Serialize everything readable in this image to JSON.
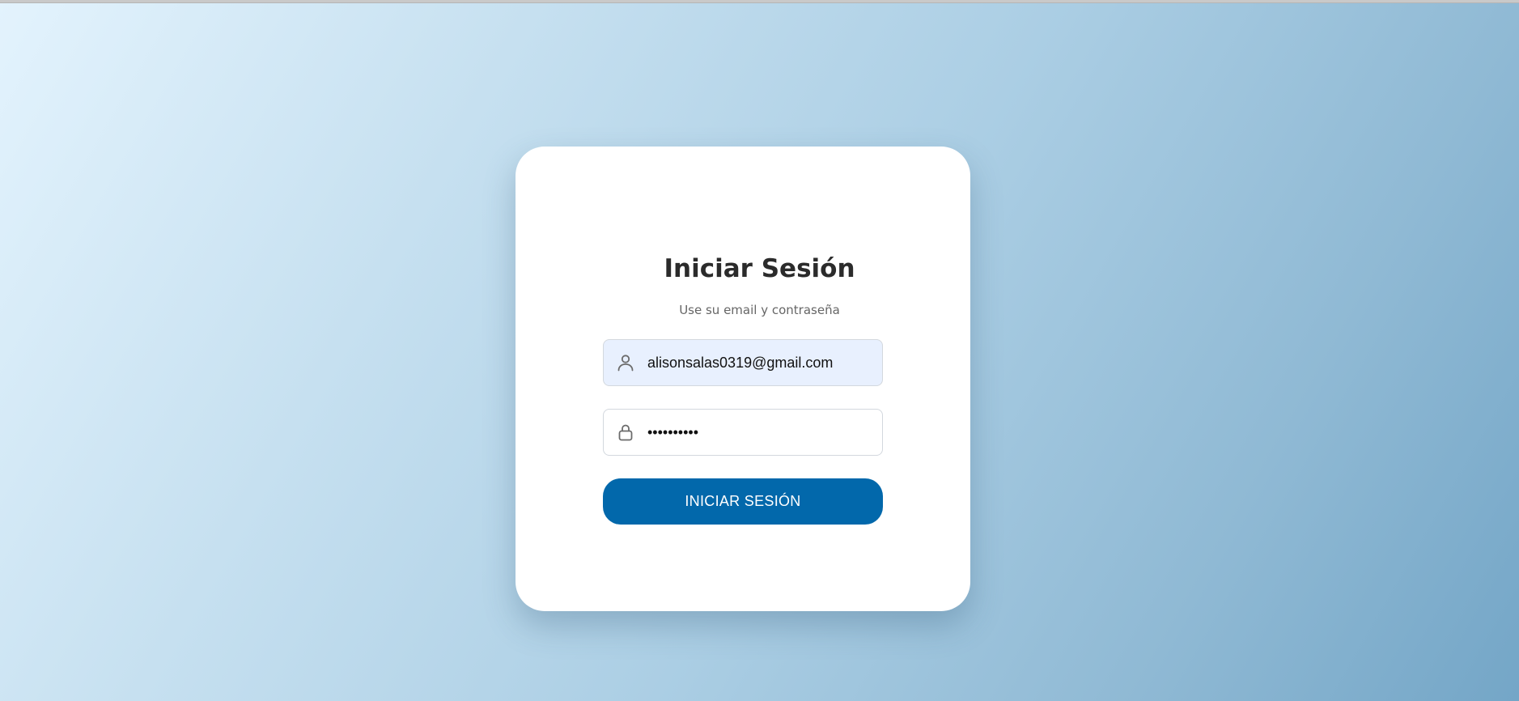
{
  "login": {
    "title": "Iniciar Sesión",
    "subtitle": "Use su email y contraseña",
    "email": {
      "value": "alisonsalas0319@gmail.com",
      "icon": "user-icon"
    },
    "password": {
      "value": "••••••••••",
      "icon": "lock-icon"
    },
    "submit_label": "INICIAR SESIÓN"
  },
  "colors": {
    "button": "#0268ab",
    "email_field_bg": "#e8f0fe",
    "card_bg": "#ffffff"
  }
}
